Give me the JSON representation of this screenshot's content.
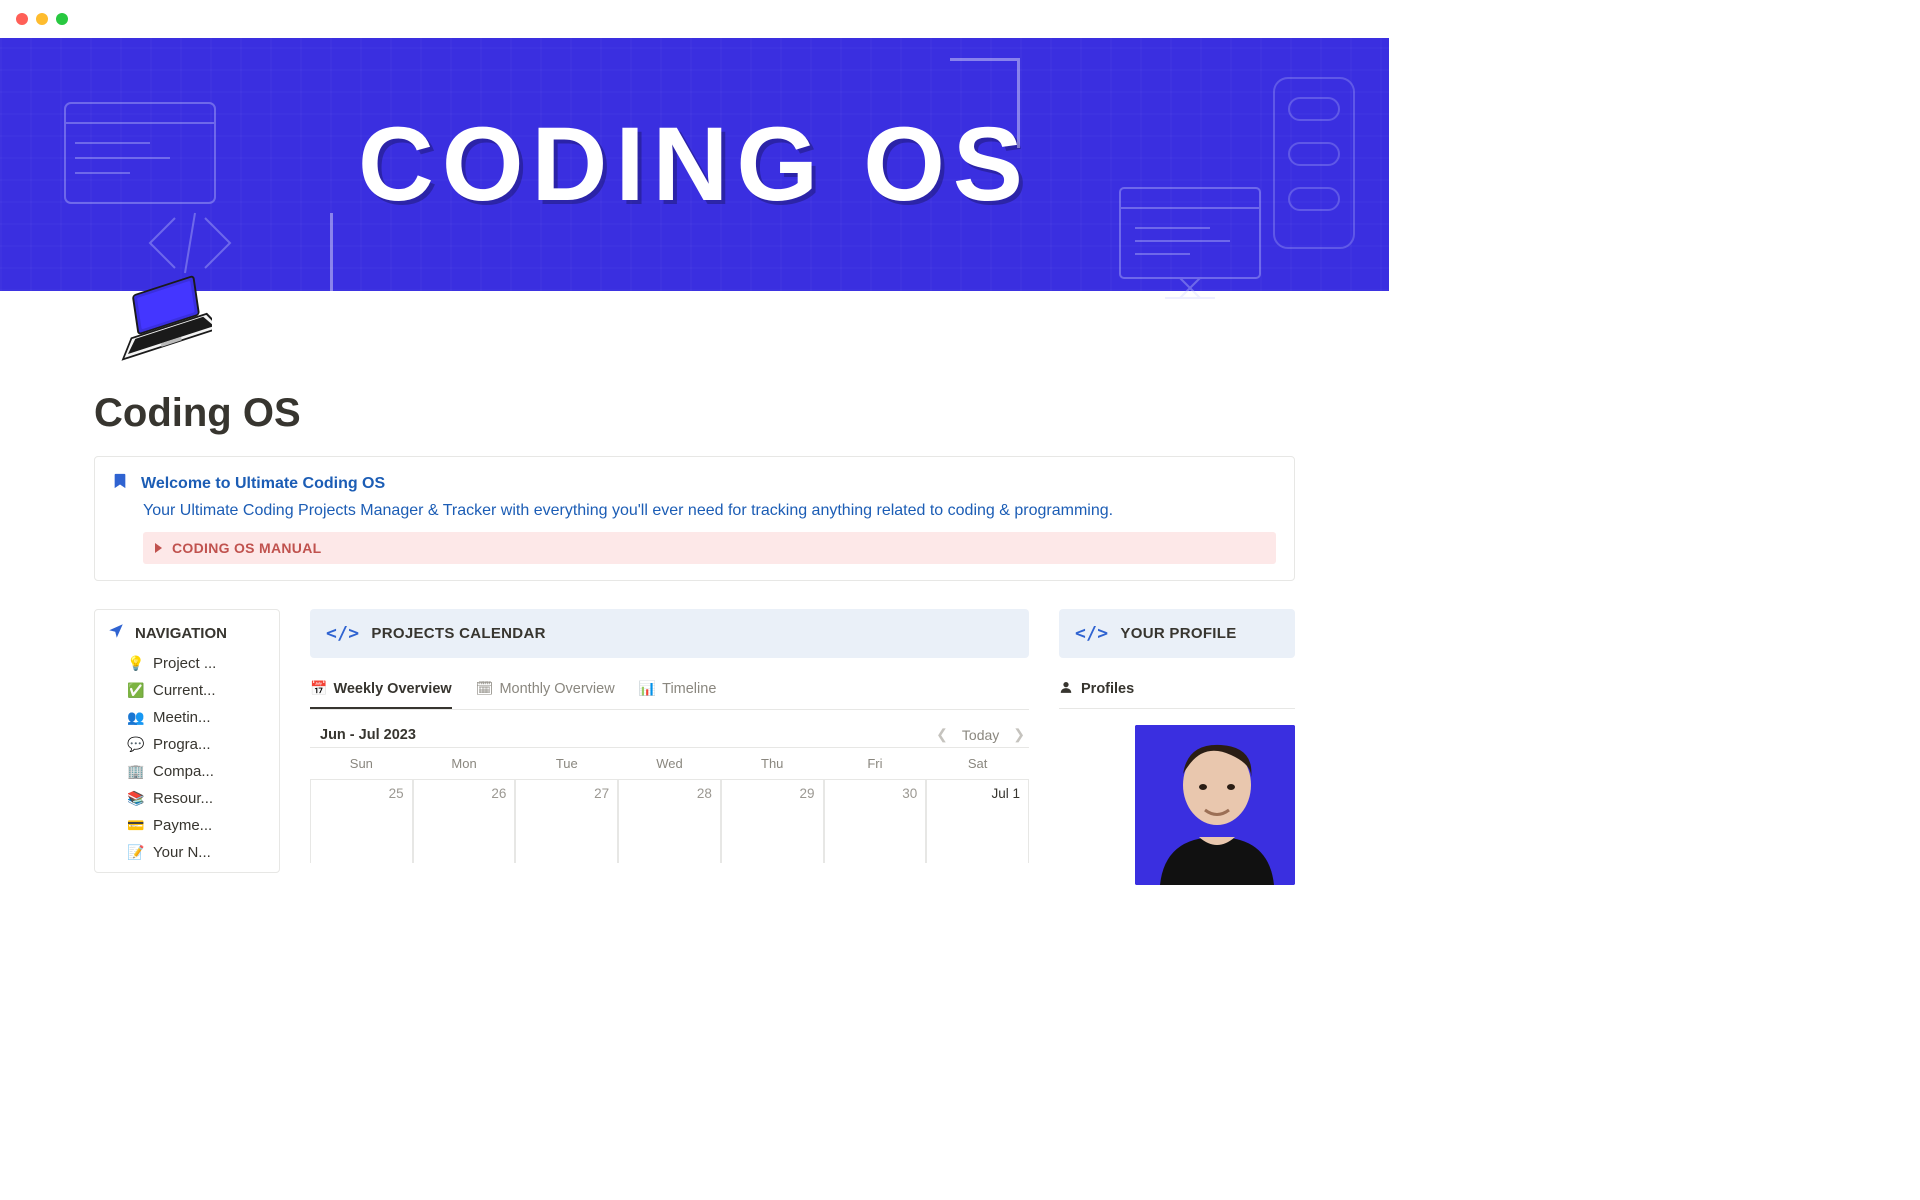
{
  "cover": {
    "title": "CODING OS"
  },
  "page": {
    "title": "Coding OS"
  },
  "callout": {
    "title": "Welcome to Ultimate Coding OS",
    "desc": "Your Ultimate Coding Projects Manager & Tracker with everything you'll ever need for tracking anything related to coding & programming.",
    "manual_label": "CODING OS MANUAL"
  },
  "navigation": {
    "title": "NAVIGATION",
    "items": [
      {
        "icon": "💡",
        "label": "Project ..."
      },
      {
        "icon": "✅",
        "label": "Current..."
      },
      {
        "icon": "👥",
        "label": "Meetin..."
      },
      {
        "icon": "💬",
        "label": "Progra..."
      },
      {
        "icon": "🏢",
        "label": "Compa..."
      },
      {
        "icon": "📚",
        "label": "Resour..."
      },
      {
        "icon": "💳",
        "label": "Payme..."
      },
      {
        "icon": "📝",
        "label": "Your N..."
      }
    ]
  },
  "main": {
    "header": "PROJECTS CALENDAR",
    "tabs": [
      {
        "icon": "📅",
        "label": "Weekly Overview",
        "active": true
      },
      {
        "icon": "🗓",
        "label": "Monthly Overview",
        "active": false
      },
      {
        "icon": "📊",
        "label": "Timeline",
        "active": false
      }
    ],
    "calendar": {
      "range_label": "Jun - Jul 2023",
      "today_label": "Today",
      "daynames": [
        "Sun",
        "Mon",
        "Tue",
        "Wed",
        "Thu",
        "Fri",
        "Sat"
      ],
      "days": [
        {
          "label": "25",
          "dim": true
        },
        {
          "label": "26",
          "dim": true
        },
        {
          "label": "27",
          "dim": true
        },
        {
          "label": "28",
          "dim": true
        },
        {
          "label": "29",
          "dim": true
        },
        {
          "label": "30",
          "dim": true
        },
        {
          "label": "Jul 1",
          "dim": false
        }
      ]
    }
  },
  "profile": {
    "header": "YOUR PROFILE",
    "tab_label": "Profiles"
  }
}
